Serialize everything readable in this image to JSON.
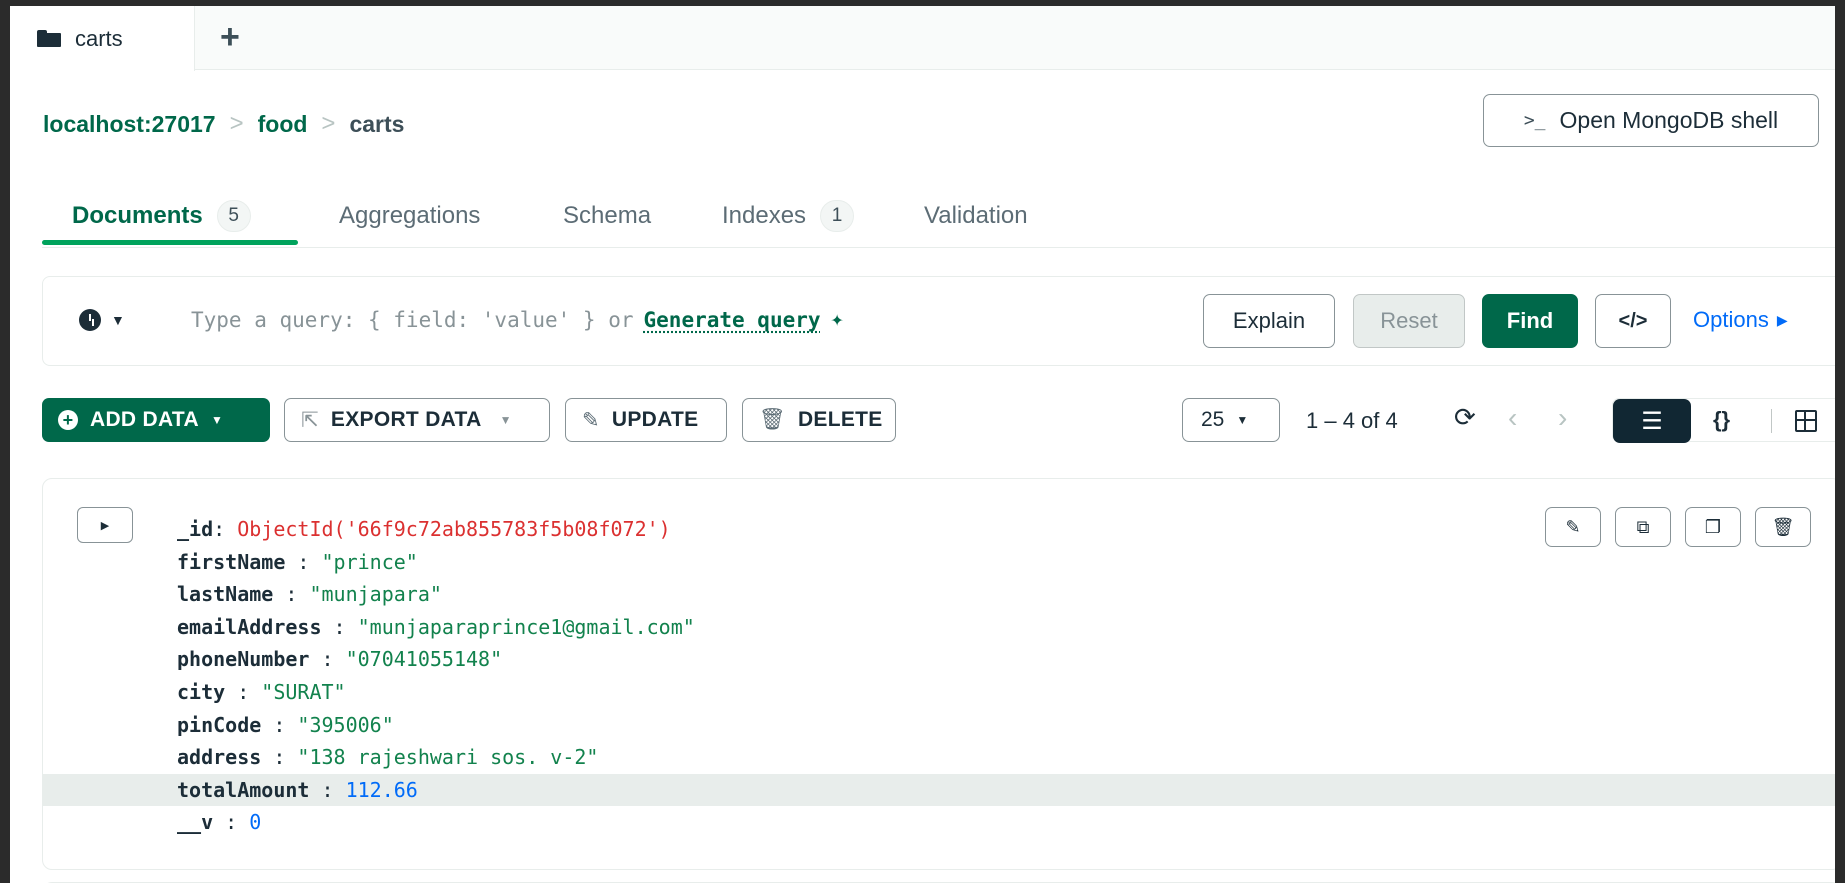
{
  "tab": {
    "label": "carts",
    "add_symbol": "+"
  },
  "breadcrumb": {
    "host": "localhost:27017",
    "db": "food",
    "collection": "carts",
    "sep": ">"
  },
  "shell_button": {
    "prompt": ">_",
    "label": "Open MongoDB shell"
  },
  "subtabs": [
    {
      "label": "Documents",
      "count": "5"
    },
    {
      "label": "Aggregations"
    },
    {
      "label": "Schema"
    },
    {
      "label": "Indexes",
      "count": "1"
    },
    {
      "label": "Validation"
    }
  ],
  "query": {
    "placeholder": "Type a query: { field: 'value' } or",
    "generate_label": "Generate query",
    "explain": "Explain",
    "reset": "Reset",
    "find": "Find",
    "code": "</>",
    "options": "Options"
  },
  "toolbar": {
    "add_data": "ADD DATA",
    "export_data": "EXPORT DATA",
    "update": "UPDATE",
    "delete": "DELETE",
    "page_size": "25",
    "range": "1 – 4 of 4"
  },
  "document": {
    "fields": [
      {
        "key": "_id",
        "value": "ObjectId('66f9c72ab855783f5b08f072')",
        "type": "oid"
      },
      {
        "key": "firstName",
        "value": "\"prince\"",
        "type": "str"
      },
      {
        "key": "lastName",
        "value": "\"munjapara\"",
        "type": "str"
      },
      {
        "key": "emailAddress",
        "value": "\"munjaparaprince1@gmail.com\"",
        "type": "str"
      },
      {
        "key": "phoneNumber",
        "value": "\"07041055148\"",
        "type": "str"
      },
      {
        "key": "city",
        "value": "\"SURAT\"",
        "type": "str"
      },
      {
        "key": "pinCode",
        "value": "\"395006\"",
        "type": "str"
      },
      {
        "key": "address",
        "value": "\"138 rajeshwari sos. v-2\"",
        "type": "str"
      },
      {
        "key": "totalAmount",
        "value": "112.66",
        "type": "num"
      },
      {
        "key": "__v",
        "value": "0",
        "type": "num"
      }
    ]
  },
  "colors": {
    "brand": "#00684a",
    "accent": "#00a35c",
    "link": "#016bf8",
    "dark": "#112733"
  }
}
